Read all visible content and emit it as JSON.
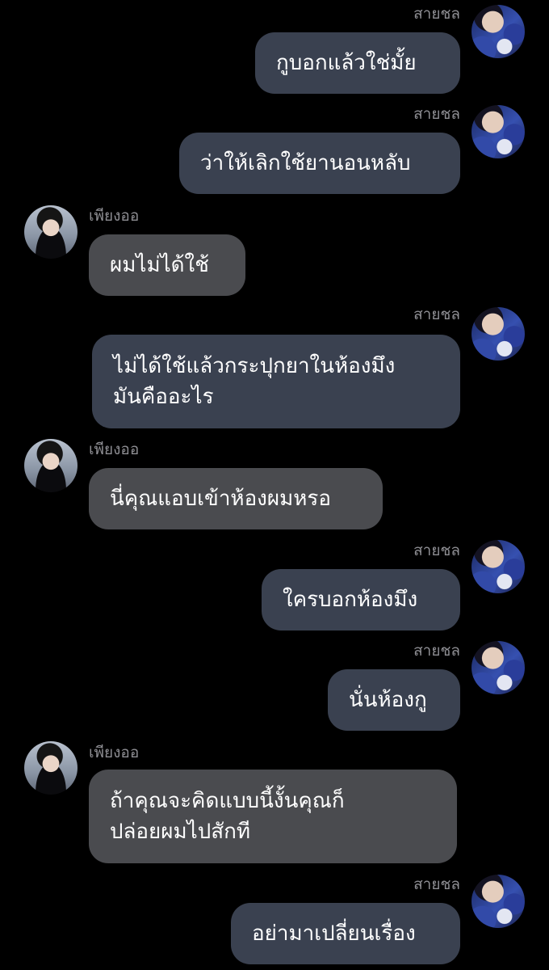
{
  "participants": {
    "sai": {
      "name": "สายชล",
      "avatar_icon": "profile-photo-icon"
    },
    "phiang": {
      "name": "เพียงออ",
      "avatar_icon": "profile-photo-icon"
    }
  },
  "colors": {
    "background": "#000000",
    "outgoing_bubble": "#3a4150",
    "incoming_bubble": "#4a4b4f",
    "sender_name": "#8e8e93",
    "message_text": "#ffffff"
  },
  "messages": [
    {
      "sender": "สายชล",
      "lines": [
        "กูบอกแล้วใช่มั้ย"
      ]
    },
    {
      "sender": "สายชล",
      "lines": [
        "ว่าให้เลิกใช้ยานอนหลับ"
      ]
    },
    {
      "sender": "เพียงออ",
      "lines": [
        "ผมไม่ได้ใช้"
      ]
    },
    {
      "sender": "สายชล",
      "lines": [
        "ไม่ได้ใช้แล้วกระปุกยาในห้องมึง",
        "มันคืออะไร"
      ]
    },
    {
      "sender": "เพียงออ",
      "lines": [
        "นี่คุณแอบเข้าห้องผมหรอ"
      ]
    },
    {
      "sender": "สายชล",
      "lines": [
        "ใครบอกห้องมึง"
      ]
    },
    {
      "sender": "สายชล",
      "lines": [
        "นั่นห้องกู"
      ]
    },
    {
      "sender": "เพียงออ",
      "lines": [
        "ถ้าคุณจะคิดแบบนี้งั้นคุณก็",
        "ปล่อยผมไปสักที"
      ]
    },
    {
      "sender": "สายชล",
      "lines": [
        "อย่ามาเปลี่ยนเรื่อง"
      ]
    }
  ]
}
